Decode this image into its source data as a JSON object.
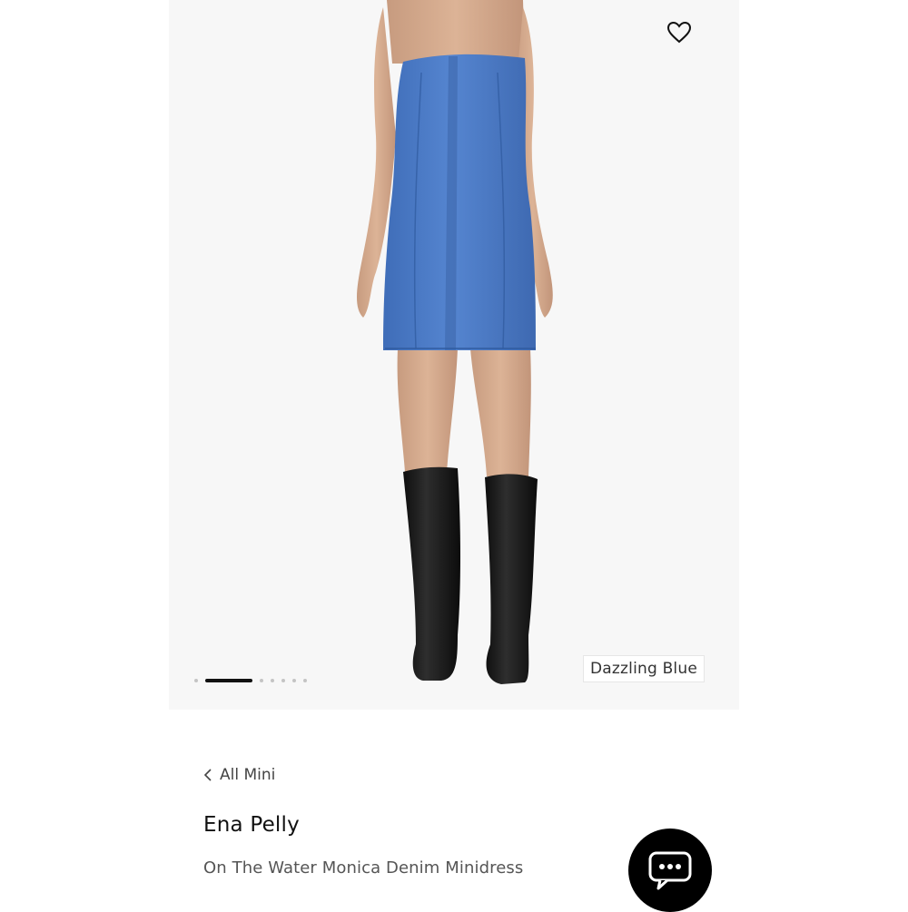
{
  "gallery": {
    "image_alt": "Model wearing strapless blue denim minidress with black knee-high boots",
    "slide_count": 7,
    "active_slide": 2,
    "color_label": "Dazzling Blue"
  },
  "favorite": {
    "icon": "heart-outline-icon"
  },
  "breadcrumb": {
    "icon": "chevron-left-icon",
    "label": "All Mini"
  },
  "product": {
    "brand": "Ena Pelly",
    "name": "On The Water Monica Denim Minidress"
  },
  "chat": {
    "icon": "chat-bubble-icon"
  },
  "colors": {
    "dress": "#4a78c4",
    "boots": "#1c1c1c",
    "accent": "#000000"
  }
}
